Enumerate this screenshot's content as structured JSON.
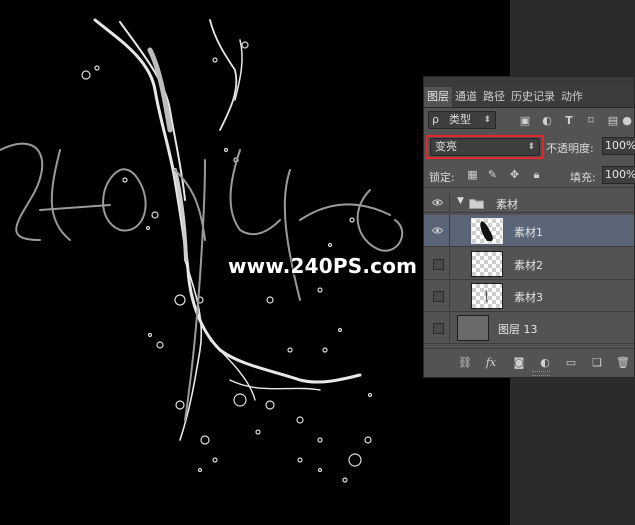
{
  "canvas": {
    "watermark_url": "www.240PS.com"
  },
  "layers_panel": {
    "tabs": [
      {
        "label": "图层",
        "active": true
      },
      {
        "label": "通道",
        "active": false
      },
      {
        "label": "路径",
        "active": false
      },
      {
        "label": "历史记录",
        "active": false
      },
      {
        "label": "动作",
        "active": false
      }
    ],
    "filter": {
      "search_symbol": "ρ",
      "kind_label": "类型"
    },
    "blend_mode": {
      "value": "变亮",
      "highlight_color": "#e4252a"
    },
    "opacity": {
      "label": "不透明度:",
      "value": "100%"
    },
    "lock": {
      "label": "锁定:"
    },
    "fill": {
      "label": "填充:",
      "value": "100%"
    },
    "layers": [
      {
        "name": "素材",
        "type": "group",
        "visible": true,
        "expanded": true
      },
      {
        "name": "素材1",
        "type": "layer",
        "visible": true,
        "selected": true
      },
      {
        "name": "素材2",
        "type": "layer",
        "visible": false,
        "selected": false
      },
      {
        "name": "素材3",
        "type": "layer",
        "visible": false,
        "selected": false
      },
      {
        "name": "图层 13",
        "type": "layer",
        "visible": false,
        "selected": false
      }
    ],
    "selection_color": "#5a6578"
  }
}
